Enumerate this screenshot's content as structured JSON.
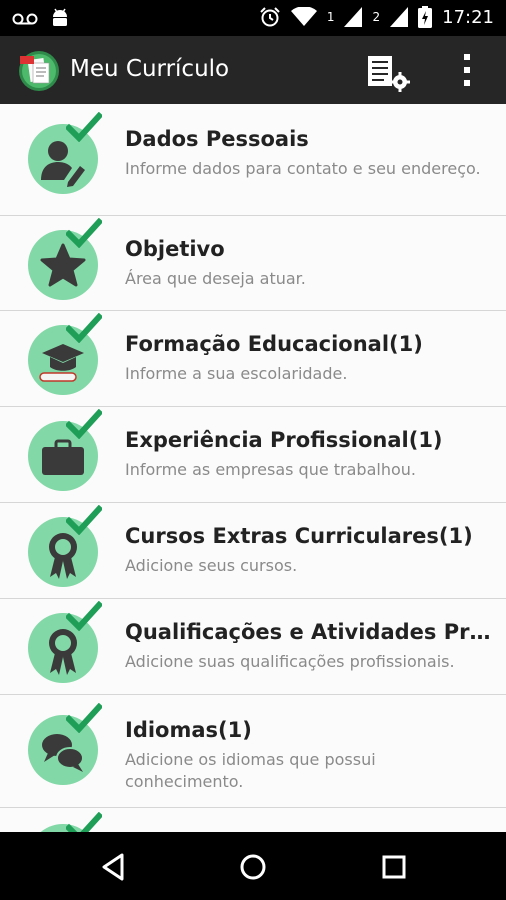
{
  "status_bar": {
    "time": "17:21",
    "sim1": "1",
    "sim2": "2",
    "icons": [
      "voicemail-icon",
      "android-icon",
      "alarm-icon",
      "wifi-icon",
      "signal-icon",
      "battery-charging-icon"
    ]
  },
  "action_bar": {
    "title": "Meu Currículo",
    "app_icon": "app-logo-icon",
    "actions": [
      "settings-list-icon",
      "overflow-menu-icon"
    ]
  },
  "colors": {
    "action_bar_bg": "#262626",
    "icon_circle": "#82d8a6",
    "check": "#1e9e57",
    "glyph": "#3a3a3a"
  },
  "sections": [
    {
      "title": "Dados Pessoais",
      "subtitle": "Informe dados para contato e seu endereço.",
      "icon": "person-edit-icon",
      "completed": true
    },
    {
      "title": "Objetivo",
      "subtitle": "Área que deseja atuar.",
      "icon": "star-icon",
      "completed": true
    },
    {
      "title": "Formação Educacional(1)",
      "subtitle": "Informe a sua escolaridade.",
      "icon": "graduation-cap-icon",
      "completed": true
    },
    {
      "title": "Experiência Profissional(1)",
      "subtitle": "Informe as empresas que trabalhou.",
      "icon": "briefcase-icon",
      "completed": true
    },
    {
      "title": "Cursos Extras Curriculares(1)",
      "subtitle": "Adicione seus cursos.",
      "icon": "award-ribbon-icon",
      "completed": true
    },
    {
      "title": "Qualificações e Atividades Pro…",
      "subtitle": "Adicione suas qualificações profissionais.",
      "icon": "award-ribbon-icon",
      "completed": true
    },
    {
      "title": "Idiomas(1)",
      "subtitle": "Adicione os idiomas que possui conhecimento.",
      "icon": "speech-bubbles-icon",
      "completed": true
    },
    {
      "title": "",
      "subtitle": "",
      "icon": "partial-item-icon",
      "completed": true
    }
  ],
  "nav_bar": {
    "buttons": [
      "back-icon",
      "home-icon",
      "recents-icon"
    ]
  }
}
